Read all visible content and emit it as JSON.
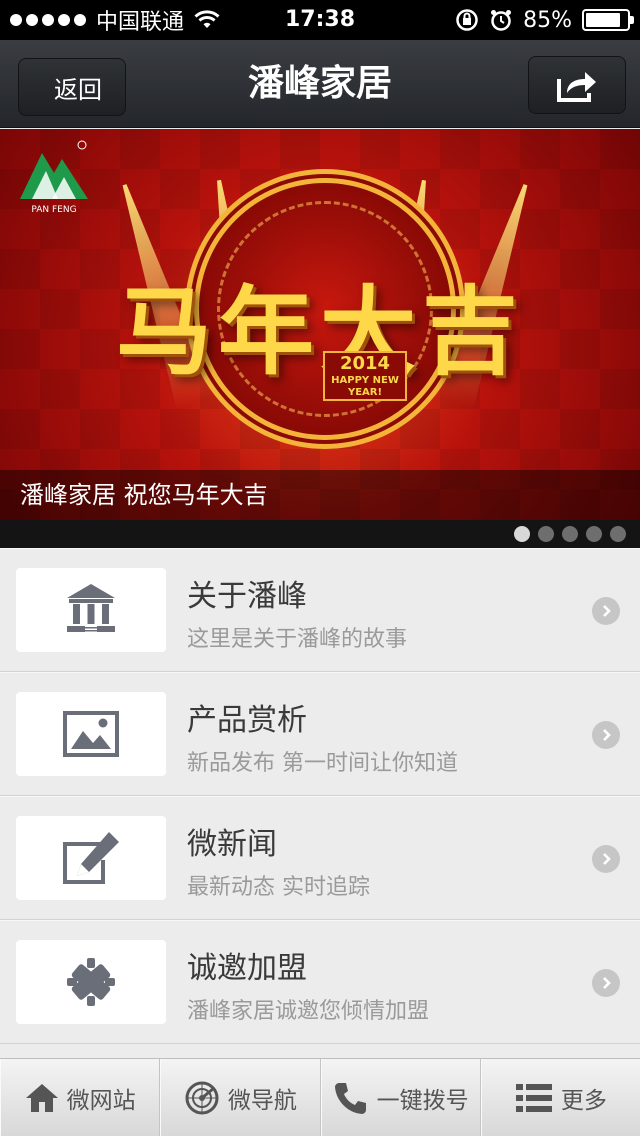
{
  "status": {
    "carrier": "中国联通",
    "time": "17:38",
    "battery": "85%",
    "battery_level": 0.85
  },
  "nav": {
    "back_label": "返回",
    "title": "潘峰家居"
  },
  "banner": {
    "headline": "马年大吉",
    "year": "2014",
    "year_tagline": "HAPPY NEW YEAR!",
    "caption": "潘峰家居 祝您马年大吉",
    "logo_text": "PAN FENG",
    "slide_count": 5,
    "active_slide": 1
  },
  "menu": [
    {
      "title": "关于潘峰",
      "subtitle": "这里是关于潘峰的故事",
      "icon": "bank-icon"
    },
    {
      "title": "产品赏析",
      "subtitle": "新品发布 第一时间让你知道",
      "icon": "picture-icon"
    },
    {
      "title": "微新闻",
      "subtitle": "最新动态 实时追踪",
      "icon": "edit-icon"
    },
    {
      "title": "诚邀加盟",
      "subtitle": "潘峰家居诚邀您倾情加盟",
      "icon": "handshake-icon"
    }
  ],
  "tabs": [
    {
      "label": "微网站",
      "icon": "home-icon"
    },
    {
      "label": "微导航",
      "icon": "radar-icon"
    },
    {
      "label": "一键拨号",
      "icon": "phone-icon"
    },
    {
      "label": "更多",
      "icon": "list-icon"
    }
  ],
  "colors": {
    "navbar": "#2c2f33",
    "banner_red": "#b8120c",
    "gold": "#ffd84a",
    "icon_gray": "#6a6e78"
  }
}
